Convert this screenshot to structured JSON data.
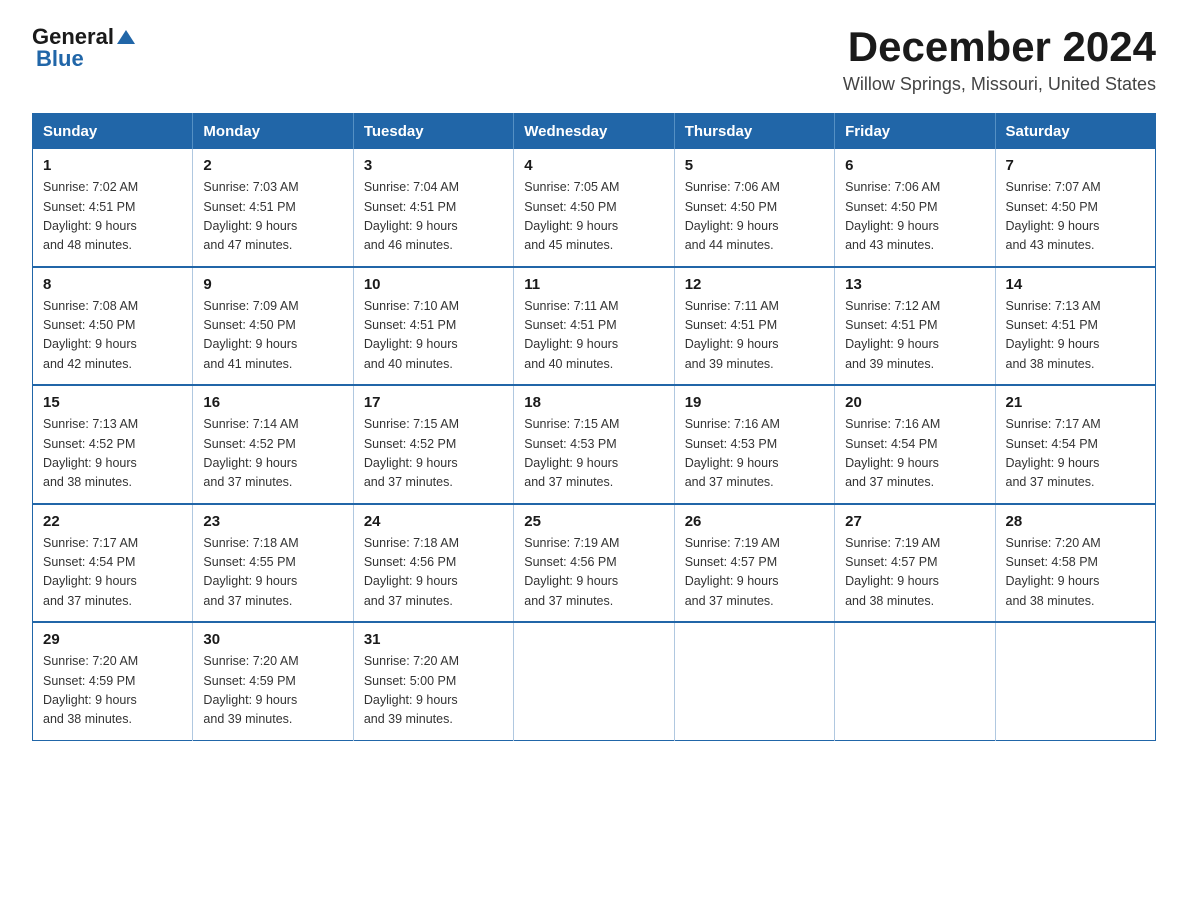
{
  "header": {
    "logo_general": "General",
    "logo_blue": "Blue",
    "month_title": "December 2024",
    "location": "Willow Springs, Missouri, United States"
  },
  "weekdays": [
    "Sunday",
    "Monday",
    "Tuesday",
    "Wednesday",
    "Thursday",
    "Friday",
    "Saturday"
  ],
  "weeks": [
    [
      {
        "day": "1",
        "sunrise": "7:02 AM",
        "sunset": "4:51 PM",
        "daylight": "9 hours and 48 minutes."
      },
      {
        "day": "2",
        "sunrise": "7:03 AM",
        "sunset": "4:51 PM",
        "daylight": "9 hours and 47 minutes."
      },
      {
        "day": "3",
        "sunrise": "7:04 AM",
        "sunset": "4:51 PM",
        "daylight": "9 hours and 46 minutes."
      },
      {
        "day": "4",
        "sunrise": "7:05 AM",
        "sunset": "4:50 PM",
        "daylight": "9 hours and 45 minutes."
      },
      {
        "day": "5",
        "sunrise": "7:06 AM",
        "sunset": "4:50 PM",
        "daylight": "9 hours and 44 minutes."
      },
      {
        "day": "6",
        "sunrise": "7:06 AM",
        "sunset": "4:50 PM",
        "daylight": "9 hours and 43 minutes."
      },
      {
        "day": "7",
        "sunrise": "7:07 AM",
        "sunset": "4:50 PM",
        "daylight": "9 hours and 43 minutes."
      }
    ],
    [
      {
        "day": "8",
        "sunrise": "7:08 AM",
        "sunset": "4:50 PM",
        "daylight": "9 hours and 42 minutes."
      },
      {
        "day": "9",
        "sunrise": "7:09 AM",
        "sunset": "4:50 PM",
        "daylight": "9 hours and 41 minutes."
      },
      {
        "day": "10",
        "sunrise": "7:10 AM",
        "sunset": "4:51 PM",
        "daylight": "9 hours and 40 minutes."
      },
      {
        "day": "11",
        "sunrise": "7:11 AM",
        "sunset": "4:51 PM",
        "daylight": "9 hours and 40 minutes."
      },
      {
        "day": "12",
        "sunrise": "7:11 AM",
        "sunset": "4:51 PM",
        "daylight": "9 hours and 39 minutes."
      },
      {
        "day": "13",
        "sunrise": "7:12 AM",
        "sunset": "4:51 PM",
        "daylight": "9 hours and 39 minutes."
      },
      {
        "day": "14",
        "sunrise": "7:13 AM",
        "sunset": "4:51 PM",
        "daylight": "9 hours and 38 minutes."
      }
    ],
    [
      {
        "day": "15",
        "sunrise": "7:13 AM",
        "sunset": "4:52 PM",
        "daylight": "9 hours and 38 minutes."
      },
      {
        "day": "16",
        "sunrise": "7:14 AM",
        "sunset": "4:52 PM",
        "daylight": "9 hours and 37 minutes."
      },
      {
        "day": "17",
        "sunrise": "7:15 AM",
        "sunset": "4:52 PM",
        "daylight": "9 hours and 37 minutes."
      },
      {
        "day": "18",
        "sunrise": "7:15 AM",
        "sunset": "4:53 PM",
        "daylight": "9 hours and 37 minutes."
      },
      {
        "day": "19",
        "sunrise": "7:16 AM",
        "sunset": "4:53 PM",
        "daylight": "9 hours and 37 minutes."
      },
      {
        "day": "20",
        "sunrise": "7:16 AM",
        "sunset": "4:54 PM",
        "daylight": "9 hours and 37 minutes."
      },
      {
        "day": "21",
        "sunrise": "7:17 AM",
        "sunset": "4:54 PM",
        "daylight": "9 hours and 37 minutes."
      }
    ],
    [
      {
        "day": "22",
        "sunrise": "7:17 AM",
        "sunset": "4:54 PM",
        "daylight": "9 hours and 37 minutes."
      },
      {
        "day": "23",
        "sunrise": "7:18 AM",
        "sunset": "4:55 PM",
        "daylight": "9 hours and 37 minutes."
      },
      {
        "day": "24",
        "sunrise": "7:18 AM",
        "sunset": "4:56 PM",
        "daylight": "9 hours and 37 minutes."
      },
      {
        "day": "25",
        "sunrise": "7:19 AM",
        "sunset": "4:56 PM",
        "daylight": "9 hours and 37 minutes."
      },
      {
        "day": "26",
        "sunrise": "7:19 AM",
        "sunset": "4:57 PM",
        "daylight": "9 hours and 37 minutes."
      },
      {
        "day": "27",
        "sunrise": "7:19 AM",
        "sunset": "4:57 PM",
        "daylight": "9 hours and 38 minutes."
      },
      {
        "day": "28",
        "sunrise": "7:20 AM",
        "sunset": "4:58 PM",
        "daylight": "9 hours and 38 minutes."
      }
    ],
    [
      {
        "day": "29",
        "sunrise": "7:20 AM",
        "sunset": "4:59 PM",
        "daylight": "9 hours and 38 minutes."
      },
      {
        "day": "30",
        "sunrise": "7:20 AM",
        "sunset": "4:59 PM",
        "daylight": "9 hours and 39 minutes."
      },
      {
        "day": "31",
        "sunrise": "7:20 AM",
        "sunset": "5:00 PM",
        "daylight": "9 hours and 39 minutes."
      },
      null,
      null,
      null,
      null
    ]
  ],
  "labels": {
    "sunrise": "Sunrise:",
    "sunset": "Sunset:",
    "daylight": "Daylight:"
  }
}
